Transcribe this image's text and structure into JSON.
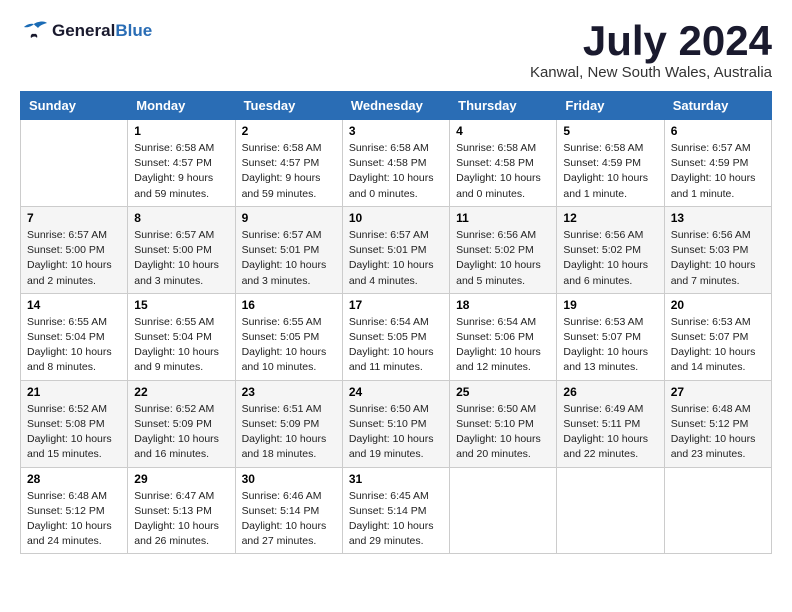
{
  "logo": {
    "line1": "General",
    "line2": "Blue"
  },
  "title": "July 2024",
  "location": "Kanwal, New South Wales, Australia",
  "weekdays": [
    "Sunday",
    "Monday",
    "Tuesday",
    "Wednesday",
    "Thursday",
    "Friday",
    "Saturday"
  ],
  "weeks": [
    [
      {
        "day": "",
        "info": ""
      },
      {
        "day": "1",
        "info": "Sunrise: 6:58 AM\nSunset: 4:57 PM\nDaylight: 9 hours\nand 59 minutes."
      },
      {
        "day": "2",
        "info": "Sunrise: 6:58 AM\nSunset: 4:57 PM\nDaylight: 9 hours\nand 59 minutes."
      },
      {
        "day": "3",
        "info": "Sunrise: 6:58 AM\nSunset: 4:58 PM\nDaylight: 10 hours\nand 0 minutes."
      },
      {
        "day": "4",
        "info": "Sunrise: 6:58 AM\nSunset: 4:58 PM\nDaylight: 10 hours\nand 0 minutes."
      },
      {
        "day": "5",
        "info": "Sunrise: 6:58 AM\nSunset: 4:59 PM\nDaylight: 10 hours\nand 1 minute."
      },
      {
        "day": "6",
        "info": "Sunrise: 6:57 AM\nSunset: 4:59 PM\nDaylight: 10 hours\nand 1 minute."
      }
    ],
    [
      {
        "day": "7",
        "info": "Sunrise: 6:57 AM\nSunset: 5:00 PM\nDaylight: 10 hours\nand 2 minutes."
      },
      {
        "day": "8",
        "info": "Sunrise: 6:57 AM\nSunset: 5:00 PM\nDaylight: 10 hours\nand 3 minutes."
      },
      {
        "day": "9",
        "info": "Sunrise: 6:57 AM\nSunset: 5:01 PM\nDaylight: 10 hours\nand 3 minutes."
      },
      {
        "day": "10",
        "info": "Sunrise: 6:57 AM\nSunset: 5:01 PM\nDaylight: 10 hours\nand 4 minutes."
      },
      {
        "day": "11",
        "info": "Sunrise: 6:56 AM\nSunset: 5:02 PM\nDaylight: 10 hours\nand 5 minutes."
      },
      {
        "day": "12",
        "info": "Sunrise: 6:56 AM\nSunset: 5:02 PM\nDaylight: 10 hours\nand 6 minutes."
      },
      {
        "day": "13",
        "info": "Sunrise: 6:56 AM\nSunset: 5:03 PM\nDaylight: 10 hours\nand 7 minutes."
      }
    ],
    [
      {
        "day": "14",
        "info": "Sunrise: 6:55 AM\nSunset: 5:04 PM\nDaylight: 10 hours\nand 8 minutes."
      },
      {
        "day": "15",
        "info": "Sunrise: 6:55 AM\nSunset: 5:04 PM\nDaylight: 10 hours\nand 9 minutes."
      },
      {
        "day": "16",
        "info": "Sunrise: 6:55 AM\nSunset: 5:05 PM\nDaylight: 10 hours\nand 10 minutes."
      },
      {
        "day": "17",
        "info": "Sunrise: 6:54 AM\nSunset: 5:05 PM\nDaylight: 10 hours\nand 11 minutes."
      },
      {
        "day": "18",
        "info": "Sunrise: 6:54 AM\nSunset: 5:06 PM\nDaylight: 10 hours\nand 12 minutes."
      },
      {
        "day": "19",
        "info": "Sunrise: 6:53 AM\nSunset: 5:07 PM\nDaylight: 10 hours\nand 13 minutes."
      },
      {
        "day": "20",
        "info": "Sunrise: 6:53 AM\nSunset: 5:07 PM\nDaylight: 10 hours\nand 14 minutes."
      }
    ],
    [
      {
        "day": "21",
        "info": "Sunrise: 6:52 AM\nSunset: 5:08 PM\nDaylight: 10 hours\nand 15 minutes."
      },
      {
        "day": "22",
        "info": "Sunrise: 6:52 AM\nSunset: 5:09 PM\nDaylight: 10 hours\nand 16 minutes."
      },
      {
        "day": "23",
        "info": "Sunrise: 6:51 AM\nSunset: 5:09 PM\nDaylight: 10 hours\nand 18 minutes."
      },
      {
        "day": "24",
        "info": "Sunrise: 6:50 AM\nSunset: 5:10 PM\nDaylight: 10 hours\nand 19 minutes."
      },
      {
        "day": "25",
        "info": "Sunrise: 6:50 AM\nSunset: 5:10 PM\nDaylight: 10 hours\nand 20 minutes."
      },
      {
        "day": "26",
        "info": "Sunrise: 6:49 AM\nSunset: 5:11 PM\nDaylight: 10 hours\nand 22 minutes."
      },
      {
        "day": "27",
        "info": "Sunrise: 6:48 AM\nSunset: 5:12 PM\nDaylight: 10 hours\nand 23 minutes."
      }
    ],
    [
      {
        "day": "28",
        "info": "Sunrise: 6:48 AM\nSunset: 5:12 PM\nDaylight: 10 hours\nand 24 minutes."
      },
      {
        "day": "29",
        "info": "Sunrise: 6:47 AM\nSunset: 5:13 PM\nDaylight: 10 hours\nand 26 minutes."
      },
      {
        "day": "30",
        "info": "Sunrise: 6:46 AM\nSunset: 5:14 PM\nDaylight: 10 hours\nand 27 minutes."
      },
      {
        "day": "31",
        "info": "Sunrise: 6:45 AM\nSunset: 5:14 PM\nDaylight: 10 hours\nand 29 minutes."
      },
      {
        "day": "",
        "info": ""
      },
      {
        "day": "",
        "info": ""
      },
      {
        "day": "",
        "info": ""
      }
    ]
  ]
}
